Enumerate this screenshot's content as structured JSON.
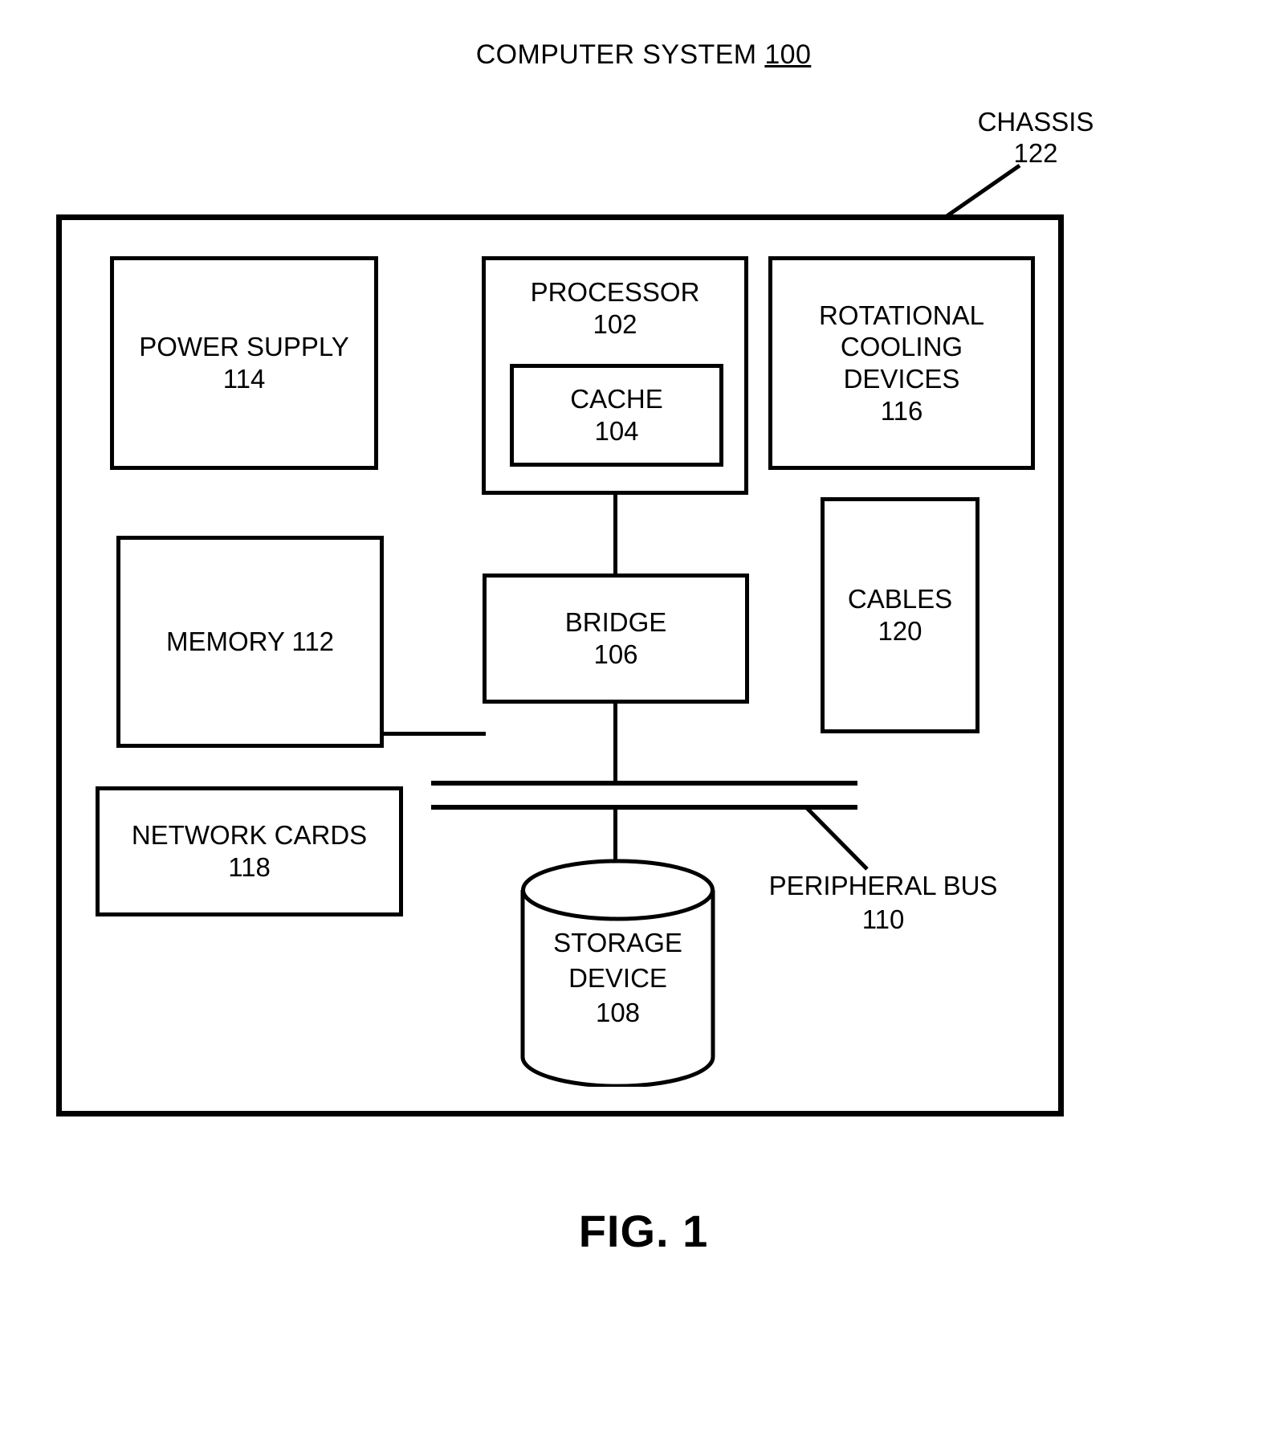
{
  "figure": {
    "title_prefix": "COMPUTER SYSTEM ",
    "title_number": "100",
    "fig_number": "FIG. 1"
  },
  "chassis": {
    "label": "CHASSIS",
    "number": "122"
  },
  "blocks": {
    "power_supply": {
      "label": "POWER SUPPLY",
      "number": "114",
      "text": "POWER SUPPLY\n114"
    },
    "processor": {
      "label": "PROCESSOR",
      "number": "102",
      "text": "PROCESSOR\n102"
    },
    "cache": {
      "label": "CACHE",
      "number": "104",
      "text": "CACHE\n104"
    },
    "cooling": {
      "label": "ROTATIONAL COOLING DEVICES",
      "number": "116",
      "text": "ROTATIONAL\nCOOLING\nDEVICES\n116"
    },
    "memory": {
      "label": "MEMORY",
      "number": "112",
      "text": "MEMORY 112"
    },
    "bridge": {
      "label": "BRIDGE",
      "number": "106",
      "text": "BRIDGE\n106"
    },
    "cables": {
      "label": "CABLES",
      "number": "120",
      "text": "CABLES\n120"
    },
    "network_cards": {
      "label": "NETWORK CARDS",
      "number": "118",
      "text": "NETWORK CARDS\n118"
    },
    "storage_device": {
      "label": "STORAGE DEVICE",
      "number": "108",
      "text": "STORAGE\nDEVICE\n108"
    }
  },
  "peripheral_bus": {
    "label": "PERIPHERAL BUS",
    "number": "110"
  },
  "colors": {
    "ink": "#000000",
    "paper": "#ffffff"
  }
}
